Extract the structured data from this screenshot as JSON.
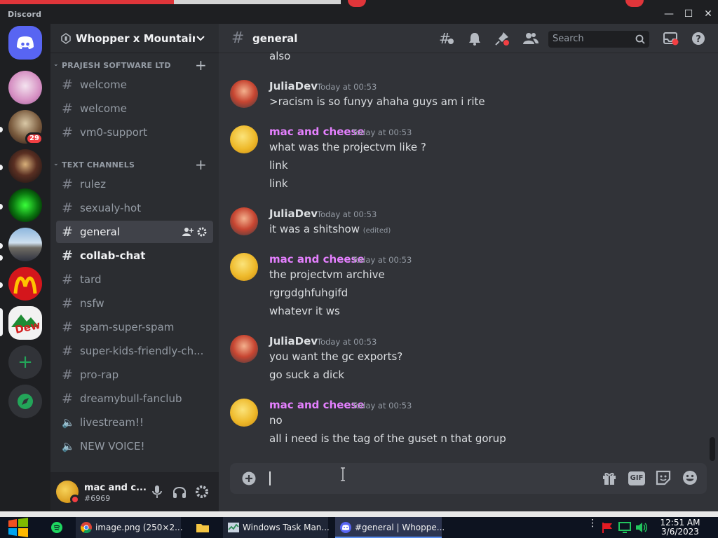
{
  "window": {
    "app_title": "Discord",
    "minimize": "—",
    "maximize": "☐",
    "close": "✕"
  },
  "rail": {
    "unread_badge": "29",
    "add_icon": "+",
    "explore_icon": "🧭"
  },
  "sidebar": {
    "guild_name": "Whopper x Mountain ...",
    "categories": [
      {
        "label": "PRAJESH SOFTWARE LTD",
        "channels": [
          {
            "name": "welcome",
            "type": "text"
          },
          {
            "name": "welcome",
            "type": "text"
          },
          {
            "name": "vm0-support",
            "type": "text"
          }
        ]
      },
      {
        "label": "TEXT CHANNELS",
        "channels": [
          {
            "name": "rulez",
            "type": "text"
          },
          {
            "name": "sexualy-hot",
            "type": "text-locked"
          },
          {
            "name": "general",
            "type": "text",
            "selected": true
          },
          {
            "name": "collab-chat",
            "type": "text",
            "unread": true
          },
          {
            "name": "tard",
            "type": "text"
          },
          {
            "name": "nsfw",
            "type": "text-nsfw"
          },
          {
            "name": "spam-super-spam",
            "type": "text"
          },
          {
            "name": "super-kids-friendly-ch...",
            "type": "text"
          },
          {
            "name": "pro-rap",
            "type": "text"
          },
          {
            "name": "dreamybull-fanclub",
            "type": "text"
          },
          {
            "name": "livestream!!",
            "type": "voice"
          },
          {
            "name": "NEW VOICE!",
            "type": "voice"
          }
        ]
      }
    ]
  },
  "user": {
    "name": "mac and c...",
    "tag": "#6969"
  },
  "header": {
    "channel_name": "general",
    "search_placeholder": "Search"
  },
  "messages": {
    "partial_top": "also",
    "groups": [
      {
        "author": "JuliaDev",
        "color": "#f2f3f5",
        "time": "Today at 00:53",
        "lines": [
          ">racism is so funyy ahaha guys am i rite"
        ]
      },
      {
        "author": "mac and cheese",
        "color": "#e580ff",
        "time": "Today at 00:53",
        "lines": [
          "what was the projectvm like ?",
          "link",
          "link"
        ]
      },
      {
        "author": "JuliaDev",
        "color": "#f2f3f5",
        "time": "Today at 00:53",
        "lines": [
          "it was a shitshow"
        ],
        "edited": "(edited)"
      },
      {
        "author": "mac and cheese",
        "color": "#e580ff",
        "time": "Today at 00:53",
        "lines": [
          "the projectvm archive",
          "rgrgdghfuhgifd",
          "whatevr it ws"
        ]
      },
      {
        "author": "JuliaDev",
        "color": "#f2f3f5",
        "time": "Today at 00:53",
        "lines": [
          "you want the gc exports?",
          "go suck a dick"
        ]
      },
      {
        "author": "mac and cheese",
        "color": "#e580ff",
        "time": "Today at 00:53",
        "lines": [
          "no",
          "all i need is the tag of the guset n that gorup"
        ]
      }
    ]
  },
  "composer": {
    "value": "",
    "gif_label": "GIF"
  },
  "taskbar": {
    "items": [
      {
        "label": "image.png (250×2..."
      },
      {
        "label": ""
      },
      {
        "label": "Windows Task Man..."
      },
      {
        "label": "#general | Whoppe..."
      }
    ],
    "clock_time": "12:51 AM",
    "clock_date": "3/6/2023"
  },
  "colors": {
    "accent": "#5865f2",
    "username_mac": "#e580ff",
    "danger": "#f23f43",
    "online": "#23a559"
  }
}
